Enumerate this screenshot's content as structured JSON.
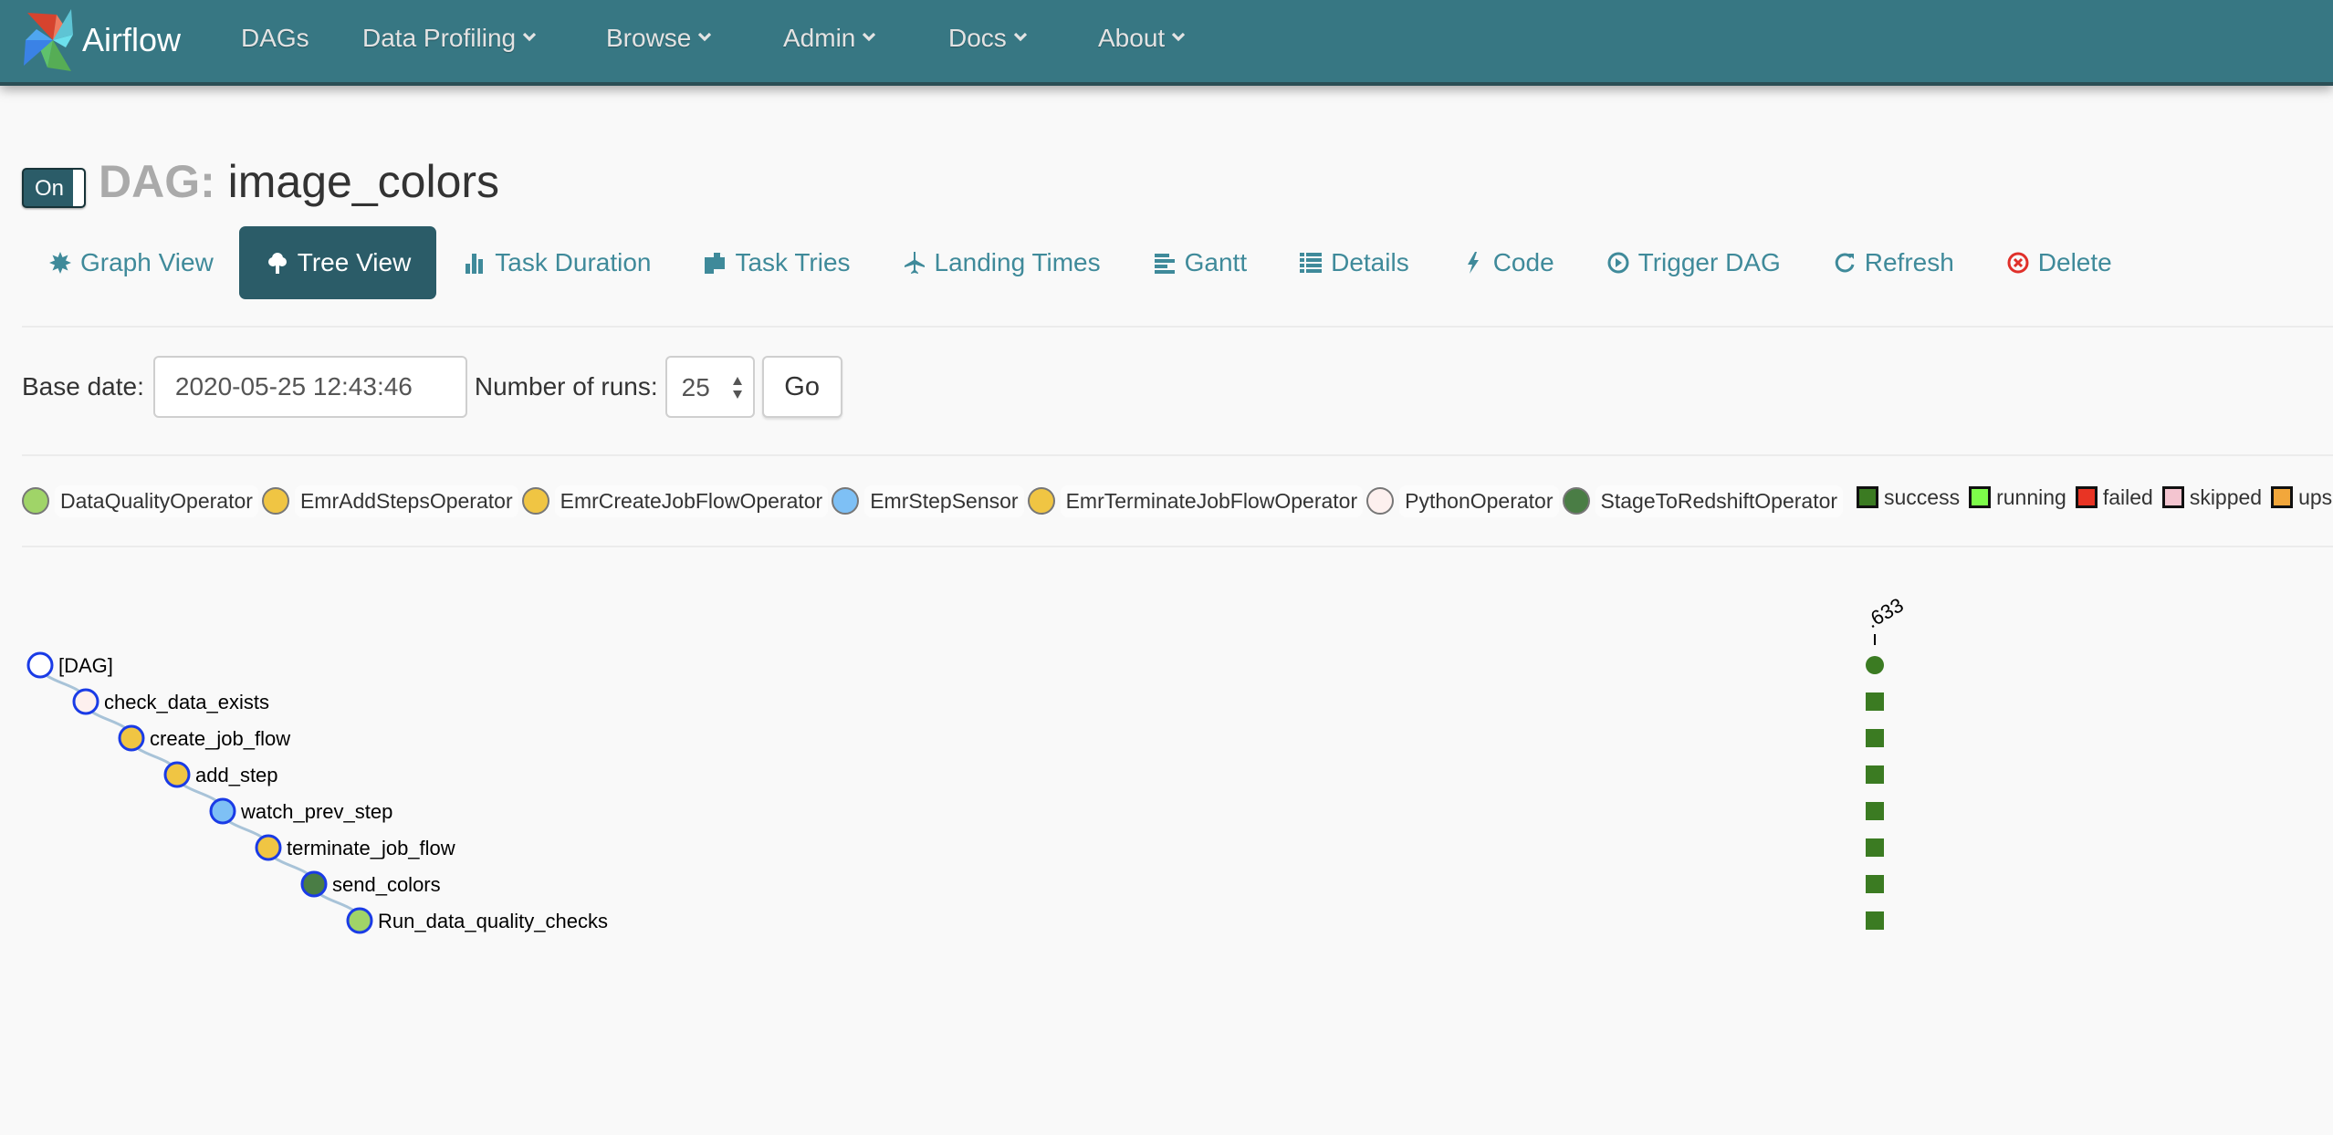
{
  "navbar": {
    "brand": "Airflow",
    "items": [
      {
        "label": "DAGs",
        "dropdown": false
      },
      {
        "label": "Data Profiling",
        "dropdown": true
      },
      {
        "label": "Browse",
        "dropdown": true
      },
      {
        "label": "Admin",
        "dropdown": true
      },
      {
        "label": "Docs",
        "dropdown": true
      },
      {
        "label": "About",
        "dropdown": true
      }
    ]
  },
  "dag": {
    "toggle_label": "On",
    "title_prefix": "DAG:",
    "title": "image_colors"
  },
  "tabs": [
    {
      "label": "Graph View",
      "icon": "asterisk-icon",
      "active": false
    },
    {
      "label": "Tree View",
      "icon": "tree-icon",
      "active": true
    },
    {
      "label": "Task Duration",
      "icon": "bar-chart-icon",
      "active": false
    },
    {
      "label": "Task Tries",
      "icon": "duplicate-file-icon",
      "active": false
    },
    {
      "label": "Landing Times",
      "icon": "plane-icon",
      "active": false
    },
    {
      "label": "Gantt",
      "icon": "align-left-icon",
      "active": false
    },
    {
      "label": "Details",
      "icon": "list-icon",
      "active": false
    },
    {
      "label": "Code",
      "icon": "flash-icon",
      "active": false
    },
    {
      "label": "Trigger DAG",
      "icon": "play-circle-icon",
      "active": false
    },
    {
      "label": "Refresh",
      "icon": "refresh-icon",
      "active": false
    },
    {
      "label": "Delete",
      "icon": "remove-circle-icon",
      "active": false
    }
  ],
  "form": {
    "base_date_label": "Base date:",
    "base_date_value": "2020-05-25 12:43:46",
    "runs_label": "Number of runs:",
    "runs_value": "25",
    "go_label": "Go"
  },
  "operator_legend": [
    {
      "name": "DataQualityOperator",
      "color": "#a0d468"
    },
    {
      "name": "EmrAddStepsOperator",
      "color": "#f0c543"
    },
    {
      "name": "EmrCreateJobFlowOperator",
      "color": "#f0c543"
    },
    {
      "name": "EmrStepSensor",
      "color": "#7ec0f5"
    },
    {
      "name": "EmrTerminateJobFlowOperator",
      "color": "#f0c543"
    },
    {
      "name": "PythonOperator",
      "color": "#fdf0ee"
    },
    {
      "name": "StageToRedshiftOperator",
      "color": "#4a7d45"
    }
  ],
  "state_legend": [
    {
      "name": "success",
      "color": "#3b7b22"
    },
    {
      "name": "running",
      "color": "#7efc4a"
    },
    {
      "name": "failed",
      "color": "#e83424"
    },
    {
      "name": "skipped",
      "color": "#f4c5d0"
    },
    {
      "name": "upstream_failed",
      "display": "ups",
      "color": "#f2a73b"
    }
  ],
  "tree": {
    "run_label": ".633",
    "run_state": "success",
    "nodes": [
      {
        "label": "[DAG]",
        "depth": 0,
        "fill": "#ffffff",
        "state": "success"
      },
      {
        "label": "check_data_exists",
        "depth": 1,
        "fill": "#fdf0ee",
        "state": "success"
      },
      {
        "label": "create_job_flow",
        "depth": 2,
        "fill": "#f0c543",
        "state": "success"
      },
      {
        "label": "add_step",
        "depth": 3,
        "fill": "#f0c543",
        "state": "success"
      },
      {
        "label": "watch_prev_step",
        "depth": 4,
        "fill": "#7ec0f5",
        "state": "success"
      },
      {
        "label": "terminate_job_flow",
        "depth": 5,
        "fill": "#f0c543",
        "state": "success"
      },
      {
        "label": "send_colors",
        "depth": 6,
        "fill": "#4a7d45",
        "state": "success"
      },
      {
        "label": "Run_data_quality_checks",
        "depth": 7,
        "fill": "#a0d468",
        "state": "success"
      }
    ],
    "state_colors": {
      "success": "#3b7b22"
    }
  },
  "colors": {
    "navbar": "#377783",
    "active_tab": "#2b5c68",
    "link": "#3f8a9a",
    "delete_icon": "#e0302a",
    "node_stroke": "#1a3be6",
    "link_line": "#a8c3d8"
  }
}
